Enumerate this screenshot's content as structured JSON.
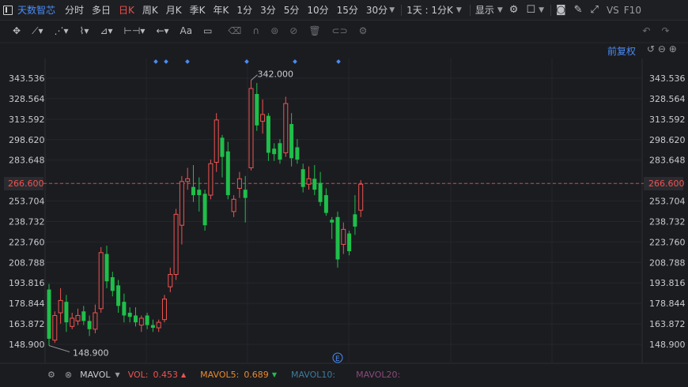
{
  "topbar": {
    "stock_name": "天数智芯",
    "periods": [
      {
        "label": "分时"
      },
      {
        "label": "多日"
      },
      {
        "label": "日K",
        "active": true
      },
      {
        "label": "周K"
      },
      {
        "label": "月K"
      },
      {
        "label": "季K"
      },
      {
        "label": "年K"
      },
      {
        "label": "1分"
      },
      {
        "label": "3分"
      },
      {
        "label": "5分"
      },
      {
        "label": "10分"
      },
      {
        "label": "15分"
      },
      {
        "label": "30分"
      }
    ],
    "range_select": "1天 : 1分K",
    "display_label": "显示",
    "vs_label": "VS",
    "f10_label": "F10"
  },
  "adjust_label": "前复权",
  "y_axis_labels": [
    "343.536",
    "328.564",
    "313.592",
    "298.620",
    "283.648",
    "266.600",
    "253.704",
    "238.732",
    "223.760",
    "208.788",
    "193.816",
    "178.844",
    "163.872",
    "148.900"
  ],
  "current_price": "266.600",
  "high_annotation": "342.000",
  "low_annotation": "148.900",
  "event_marker": "E",
  "mavol": {
    "label": "MAVOL",
    "vol_label": "VOL:",
    "vol_value": "0.453",
    "mavol5_label": "MAVOL5:",
    "mavol5_value": "0.689",
    "mavol10_label": "MAVOL10:",
    "mavol20_label": "MAVOL20:"
  },
  "colors": {
    "up": "#ef5350",
    "down": "#1fbf4a",
    "accent": "#4a8cf5",
    "active": "#ef4d4d"
  },
  "chart_data": {
    "type": "candlestick",
    "y_range": [
      148.9,
      343.536
    ],
    "candles": [
      {
        "o": 189,
        "h": 193,
        "l": 148,
        "c": 153
      },
      {
        "o": 152,
        "h": 173,
        "l": 150,
        "c": 170
      },
      {
        "o": 172,
        "h": 190,
        "l": 164,
        "c": 181
      },
      {
        "o": 180,
        "h": 185,
        "l": 158,
        "c": 165
      },
      {
        "o": 162,
        "h": 172,
        "l": 160,
        "c": 168
      },
      {
        "o": 166,
        "h": 175,
        "l": 163,
        "c": 170
      },
      {
        "o": 173,
        "h": 177,
        "l": 163,
        "c": 166
      },
      {
        "o": 166,
        "h": 170,
        "l": 155,
        "c": 160
      },
      {
        "o": 160,
        "h": 178,
        "l": 157,
        "c": 172
      },
      {
        "o": 175,
        "h": 220,
        "l": 172,
        "c": 216
      },
      {
        "o": 215,
        "h": 221,
        "l": 190,
        "c": 195
      },
      {
        "o": 198,
        "h": 202,
        "l": 184,
        "c": 188
      },
      {
        "o": 192,
        "h": 196,
        "l": 172,
        "c": 177
      },
      {
        "o": 180,
        "h": 186,
        "l": 165,
        "c": 170
      },
      {
        "o": 172,
        "h": 176,
        "l": 165,
        "c": 169
      },
      {
        "o": 170,
        "h": 176,
        "l": 162,
        "c": 165
      },
      {
        "o": 163,
        "h": 170,
        "l": 158,
        "c": 168
      },
      {
        "o": 170,
        "h": 172,
        "l": 160,
        "c": 163
      },
      {
        "o": 163,
        "h": 167,
        "l": 158,
        "c": 161
      },
      {
        "o": 161,
        "h": 167,
        "l": 158,
        "c": 165
      },
      {
        "o": 167,
        "h": 185,
        "l": 165,
        "c": 182
      },
      {
        "o": 191,
        "h": 205,
        "l": 187,
        "c": 200
      },
      {
        "o": 200,
        "h": 248,
        "l": 196,
        "c": 244
      },
      {
        "o": 236,
        "h": 272,
        "l": 222,
        "c": 268
      },
      {
        "o": 268,
        "h": 278,
        "l": 262,
        "c": 270
      },
      {
        "o": 264,
        "h": 280,
        "l": 253,
        "c": 258
      },
      {
        "o": 262,
        "h": 271,
        "l": 246,
        "c": 258
      },
      {
        "o": 259,
        "h": 262,
        "l": 232,
        "c": 236
      },
      {
        "o": 258,
        "h": 284,
        "l": 255,
        "c": 281
      },
      {
        "o": 282,
        "h": 318,
        "l": 275,
        "c": 313
      },
      {
        "o": 300,
        "h": 302,
        "l": 271,
        "c": 286
      },
      {
        "o": 290,
        "h": 297,
        "l": 255,
        "c": 258
      },
      {
        "o": 246,
        "h": 258,
        "l": 242,
        "c": 255
      },
      {
        "o": 263,
        "h": 275,
        "l": 256,
        "c": 270
      },
      {
        "o": 262,
        "h": 272,
        "l": 238,
        "c": 256
      },
      {
        "o": 278,
        "h": 342,
        "l": 276,
        "c": 336
      },
      {
        "o": 332,
        "h": 340,
        "l": 305,
        "c": 309
      },
      {
        "o": 312,
        "h": 328,
        "l": 303,
        "c": 317
      },
      {
        "o": 316,
        "h": 318,
        "l": 283,
        "c": 289
      },
      {
        "o": 292,
        "h": 296,
        "l": 283,
        "c": 288
      },
      {
        "o": 296,
        "h": 299,
        "l": 281,
        "c": 284
      },
      {
        "o": 289,
        "h": 330,
        "l": 286,
        "c": 325
      },
      {
        "o": 310,
        "h": 318,
        "l": 279,
        "c": 285
      },
      {
        "o": 293,
        "h": 299,
        "l": 281,
        "c": 284
      },
      {
        "o": 277,
        "h": 281,
        "l": 260,
        "c": 264
      },
      {
        "o": 266,
        "h": 279,
        "l": 262,
        "c": 270
      },
      {
        "o": 270,
        "h": 280,
        "l": 258,
        "c": 262
      },
      {
        "o": 267,
        "h": 275,
        "l": 250,
        "c": 253
      },
      {
        "o": 258,
        "h": 263,
        "l": 243,
        "c": 245
      },
      {
        "o": 240,
        "h": 242,
        "l": 226,
        "c": 238
      },
      {
        "o": 242,
        "h": 246,
        "l": 205,
        "c": 211
      },
      {
        "o": 222,
        "h": 238,
        "l": 215,
        "c": 233
      },
      {
        "o": 230,
        "h": 232,
        "l": 214,
        "c": 217
      },
      {
        "o": 244,
        "h": 258,
        "l": 229,
        "c": 235
      },
      {
        "o": 247,
        "h": 269,
        "l": 242,
        "c": 266
      }
    ]
  }
}
